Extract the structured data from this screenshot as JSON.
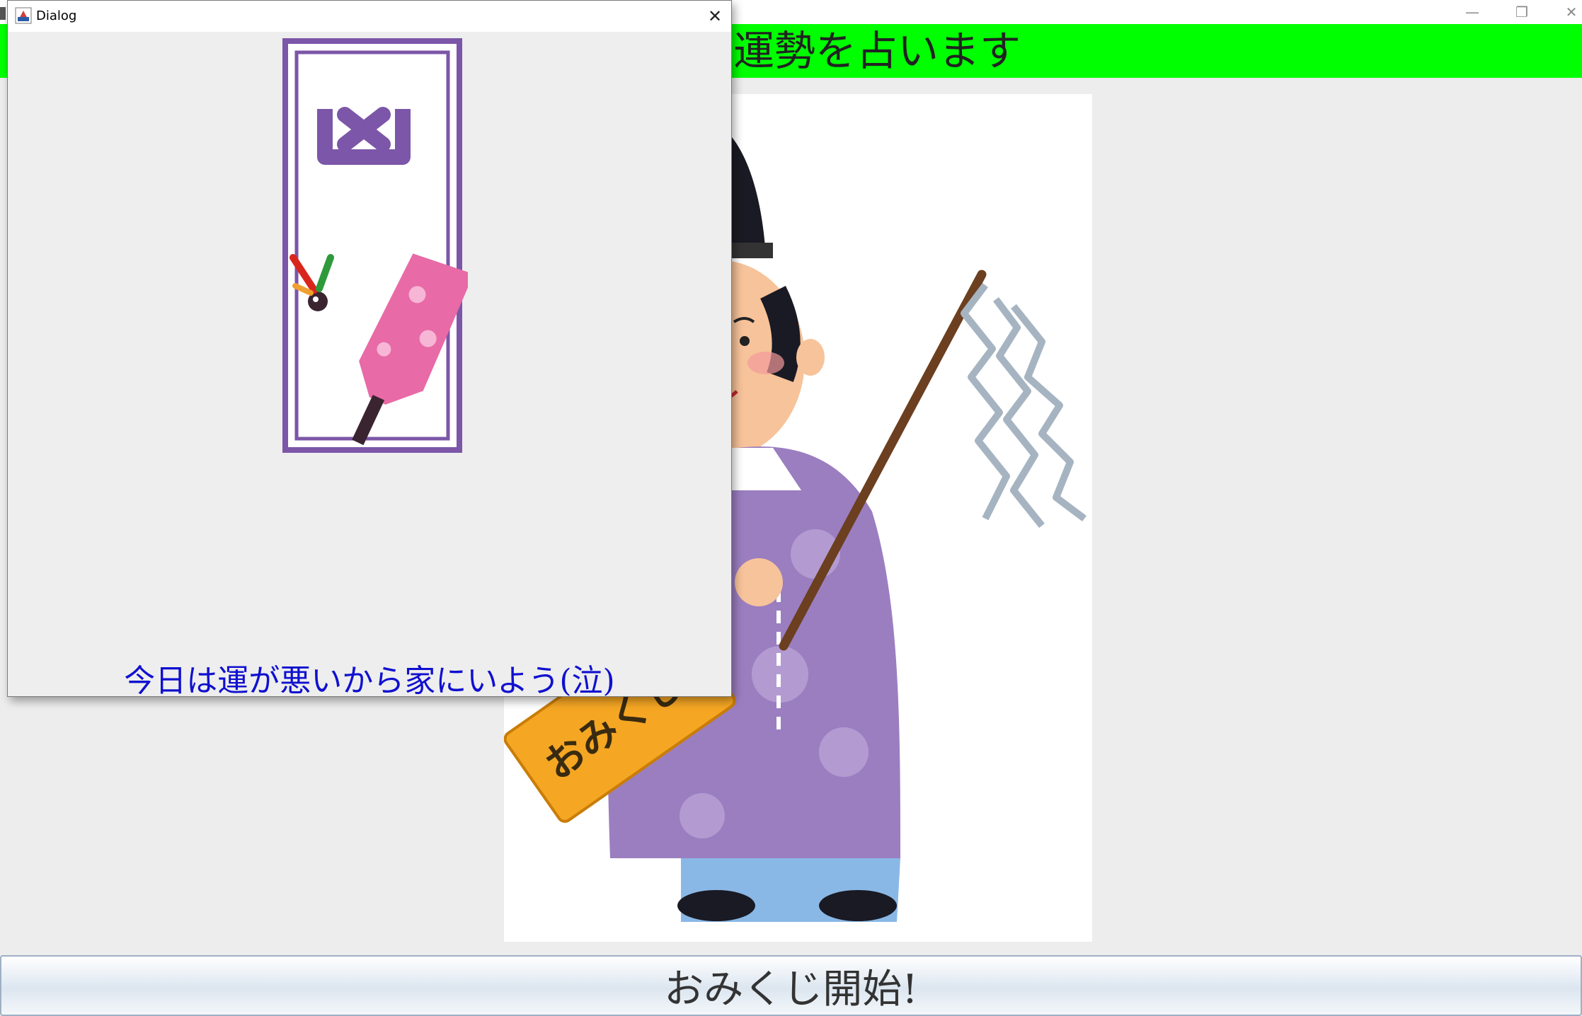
{
  "main_window": {
    "controls": {
      "minimize": "—",
      "maximize": "❐",
      "close": "✕"
    },
    "title_banner": {
      "text": "運勢を占います",
      "color": "#00ff00"
    },
    "illustration": {
      "icon": "priest-holding-omikuji-box",
      "box_text": "おみくじ"
    },
    "start_button": {
      "label": "おみくじ開始!"
    }
  },
  "dialog": {
    "title": "Dialog",
    "close": "✕",
    "fortune_slip": {
      "icon": "kyo-fortune-slip-with-hagoita"
    },
    "message": "今日は運が悪いから家にいよう(泣)",
    "message_color": "#1010d0"
  }
}
